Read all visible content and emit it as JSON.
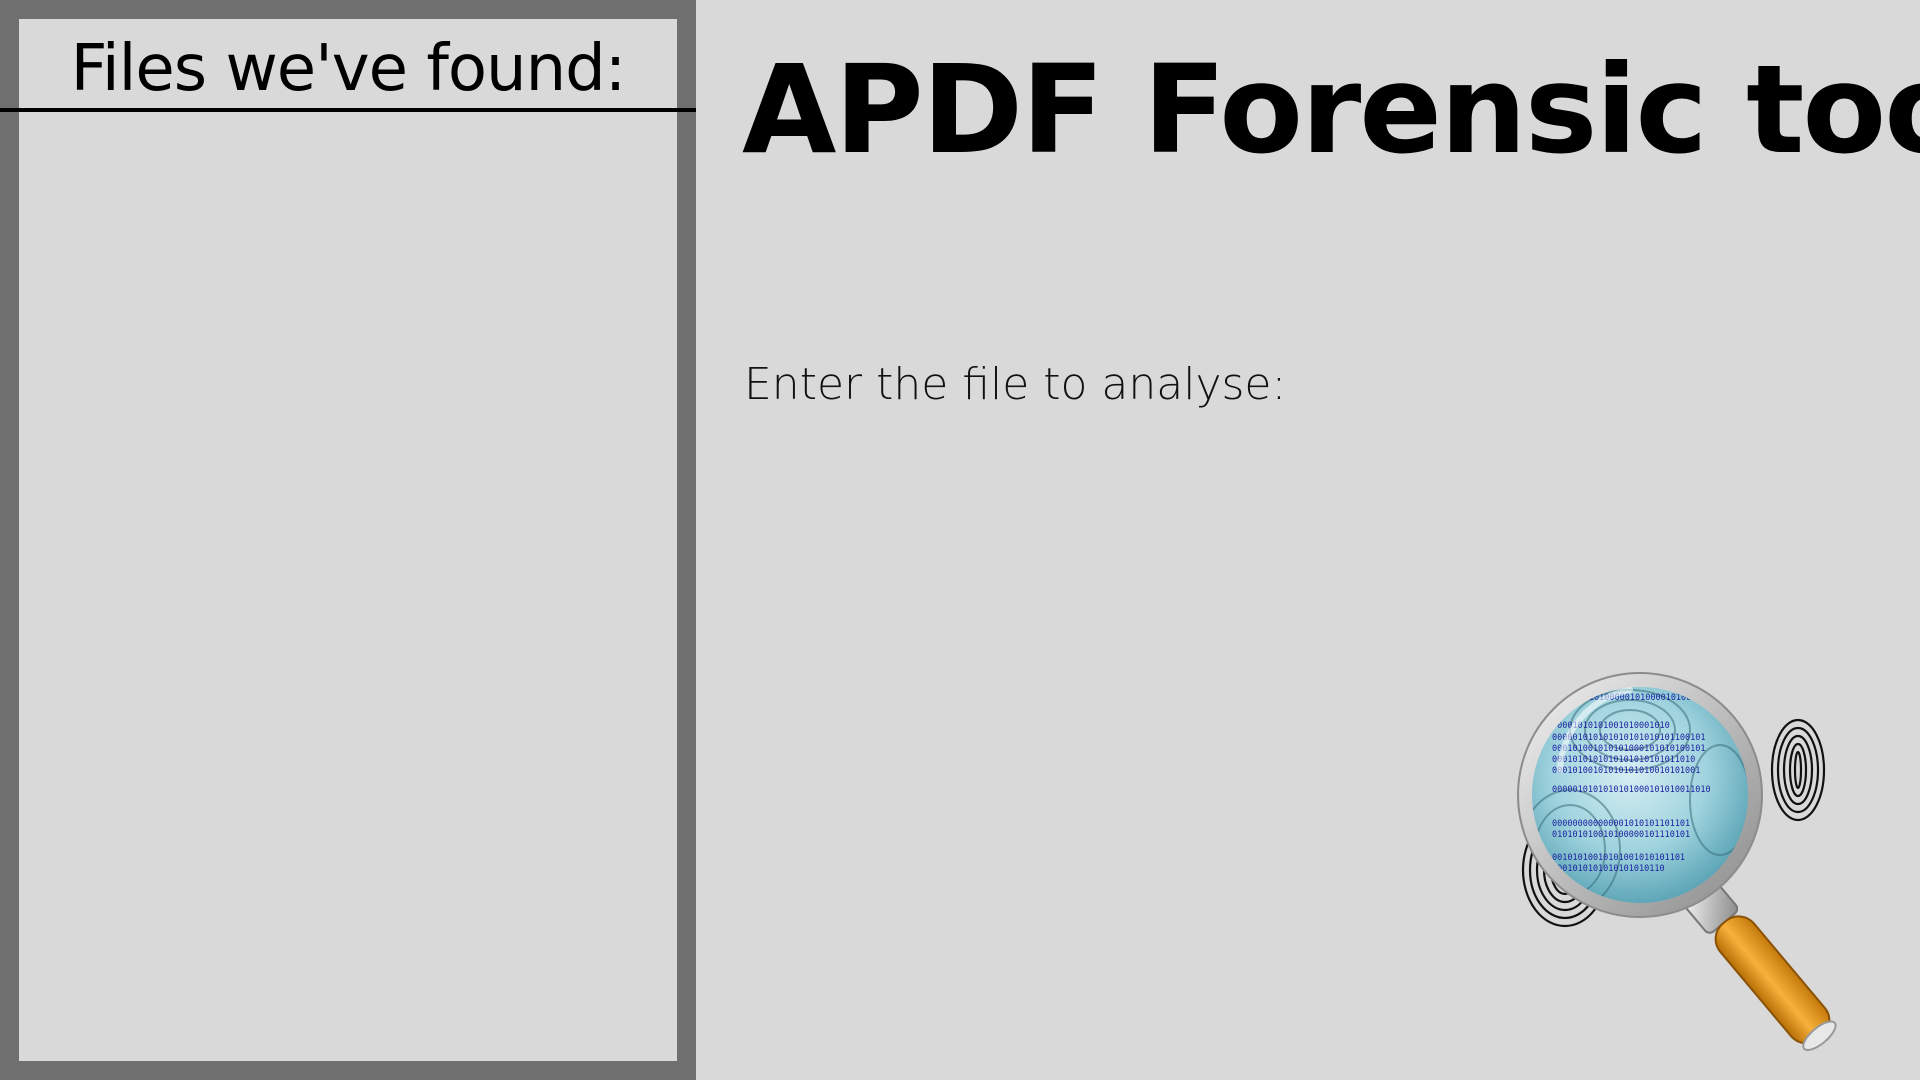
{
  "sidebar": {
    "title": "Files we've found:",
    "files": []
  },
  "main": {
    "title": "APDF Forensic tool",
    "prompt_label": "Enter the file to analyse:"
  },
  "logo": {
    "icon": "magnifying-glass-fingerprint-icon",
    "binary_lines": [
      "0010001010100000101000010100",
      "00001010101001010001010",
      "000001010101010101010101100101",
      "000101001010101000101010100101",
      "0001010101010101010101011010",
      "00010100101010101010010101001",
      "0000010101010101000101010011010",
      "000000000000001010101101101",
      "010101010010100000101110101",
      "00101010010101001010101101",
      "0001010101010101010110"
    ]
  },
  "colors": {
    "background": "#d9d9d9",
    "sidebar_border": "#6f6f6f",
    "text": "#000000",
    "handle": "#e89a1a",
    "lens": "#9fd3de"
  }
}
